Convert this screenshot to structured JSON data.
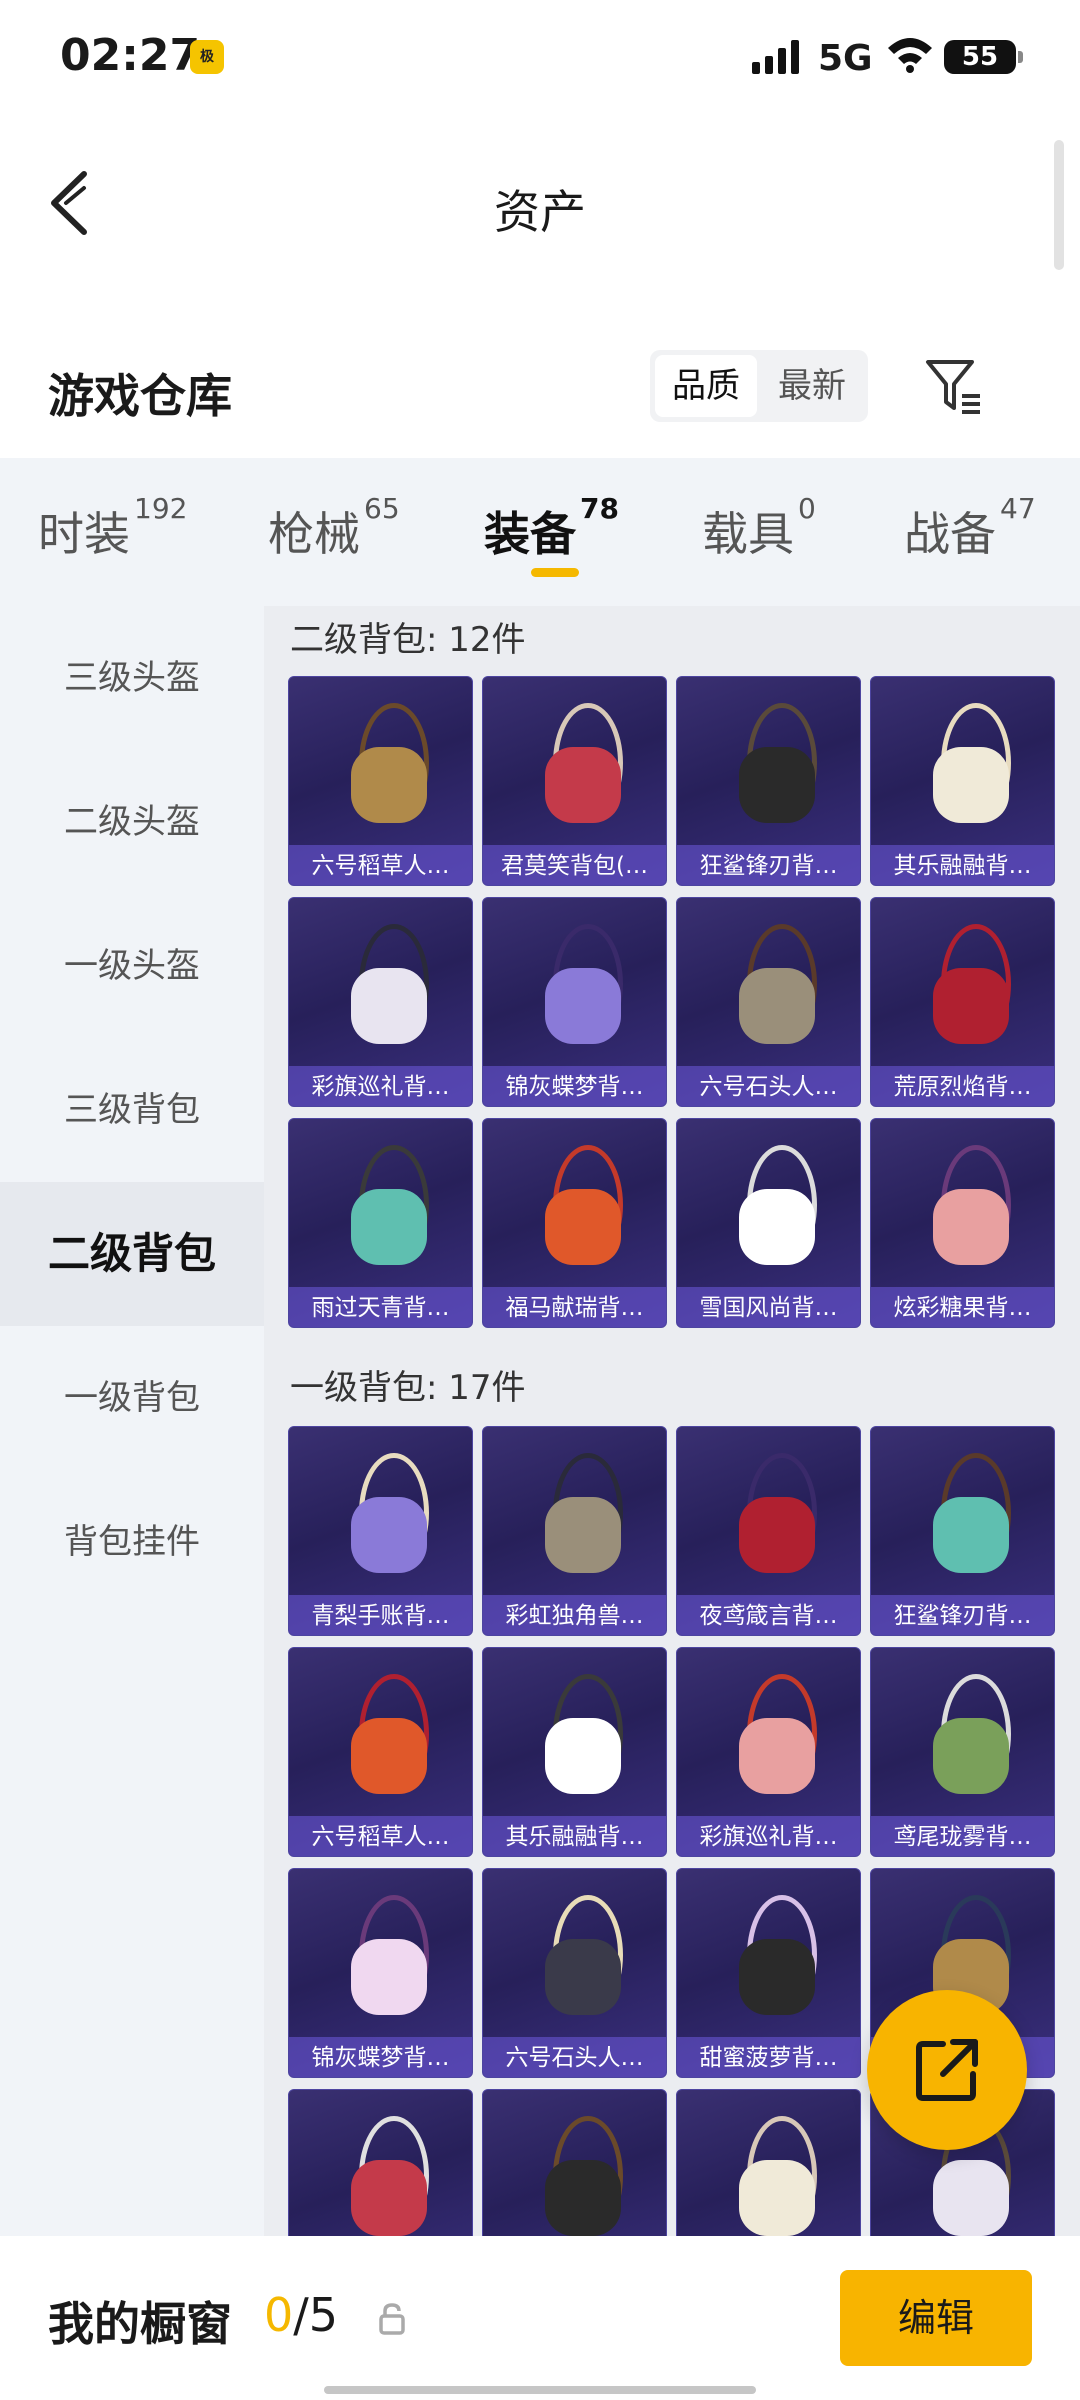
{
  "status_bar": {
    "time": "02:27",
    "app_badge": "极",
    "network": "5G",
    "battery": "55"
  },
  "header": {
    "title": "资产"
  },
  "warehouse": {
    "title": "游戏仓库",
    "sort_options": [
      "品质",
      "最新"
    ],
    "selected_sort": "品质"
  },
  "tabs": [
    {
      "label": "时装",
      "count": "192"
    },
    {
      "label": "枪械",
      "count": "65"
    },
    {
      "label": "装备",
      "count": "78",
      "active": true
    },
    {
      "label": "载具",
      "count": "0"
    },
    {
      "label": "战备",
      "count": "47"
    }
  ],
  "sidebar": {
    "items": [
      "三级头盔",
      "二级头盔",
      "一级头盔",
      "三级背包",
      "二级背包",
      "一级背包",
      "背包挂件"
    ],
    "active": "二级背包"
  },
  "sections": [
    {
      "title": "二级背包: 12件",
      "items": [
        "六号稻草人…",
        "君莫笑背包(…",
        "狂鲨锋刃背…",
        "其乐融融背…",
        "彩旗巡礼背…",
        "锦灰蝶梦背…",
        "六号石头人…",
        "荒原烈焰背…",
        "雨过天青背…",
        "福马献瑞背…",
        "雪国风尚背…",
        "炫彩糖果背…"
      ]
    },
    {
      "title": "一级背包: 17件",
      "items": [
        "青梨手账背…",
        "彩虹独角兽…",
        "夜鸢箴言背…",
        "狂鲨锋刃背…",
        "六号稻草人…",
        "其乐融融背…",
        "彩旗巡礼背…",
        "鸢尾珑雾背…",
        "锦灰蝶梦背…",
        "六号石头人…",
        "甜蜜菠萝背…",
        "",
        "",
        "",
        "",
        ""
      ]
    }
  ],
  "colors": {
    "accent": "#f5b800",
    "card_bg": "#2c2462",
    "card_label_bg": "#6e5adc"
  },
  "bottom_bar": {
    "showcase_label": "我的橱窗",
    "showcase_current": "0",
    "showcase_total": "/5",
    "edit_label": "编辑"
  }
}
